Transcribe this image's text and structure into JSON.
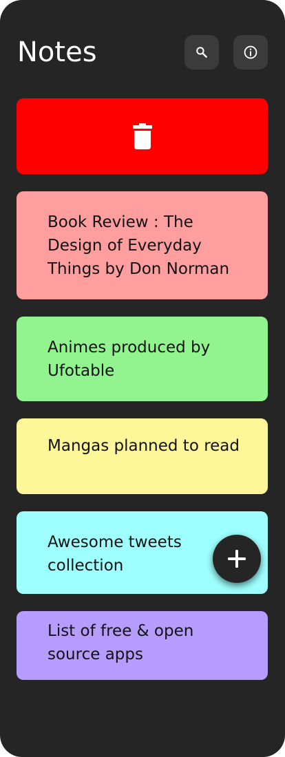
{
  "app": {
    "title": "Notes"
  },
  "header": {
    "search_icon": "search-icon",
    "info_icon": "info-icon"
  },
  "colors": {
    "background": "#252525",
    "button_bg": "#3b3b3b",
    "delete_bg": "#ff0000",
    "text_dark": "#121212"
  },
  "delete_card": {
    "icon": "trash-icon",
    "color": "#ff0000"
  },
  "notes": [
    {
      "title": "Book Review : The Design of Everyday Things by Don Norman",
      "color": "#ff9e9e"
    },
    {
      "title": "Animes produced by Ufotable",
      "color": "#91f48f"
    },
    {
      "title": "Mangas planned to read",
      "color": "#fff599"
    },
    {
      "title": "Awesome tweets collection",
      "color": "#9efffe"
    },
    {
      "title": "List of free & open source apps",
      "color": "#b69cff"
    }
  ],
  "fab": {
    "icon": "plus-icon"
  }
}
